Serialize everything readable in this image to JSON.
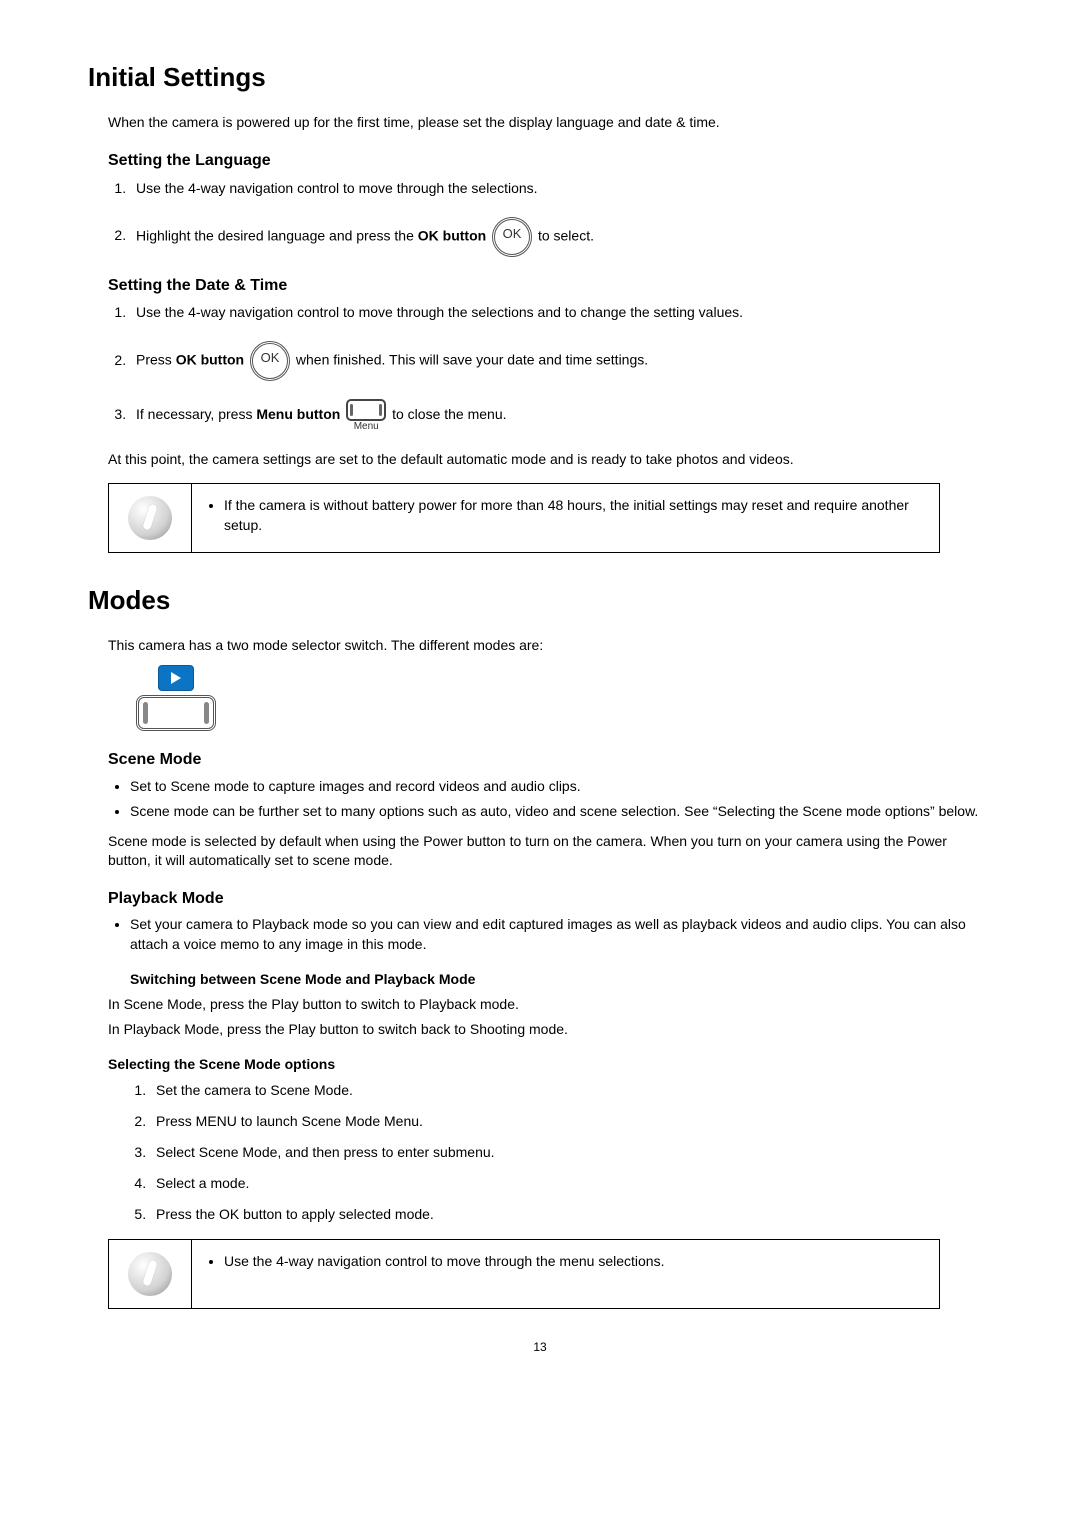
{
  "page_number": "13",
  "section1": {
    "title": "Initial Settings",
    "intro": "When the camera is powered up for the first time, please set the display language and date & time.",
    "lang": {
      "heading": "Setting the Language",
      "step1": "Use the 4-way navigation control to move through the selections.",
      "step2a": "Highlight the desired language and press the ",
      "step2b": "OK button",
      "step2c": " to select.",
      "ok_label": "OK"
    },
    "datetime": {
      "heading": "Setting the Date & Time",
      "step1": "Use the 4-way navigation control to move through the selections and to change the setting values.",
      "step2a": "Press ",
      "step2b": "OK button",
      "step2c": " when finished. This will save your date and time settings.",
      "ok_label": "OK",
      "step3a": "If necessary, press ",
      "step3b": "Menu button",
      "step3c": " to close the menu.",
      "menu_label": "Menu"
    },
    "closing": "At this point, the camera settings are set to the default automatic mode and is ready to take photos and videos.",
    "note": "If the camera is without battery power for more than 48 hours, the initial settings may reset and require another setup."
  },
  "section2": {
    "title": "Modes",
    "intro": "This camera has a two mode selector switch. The different modes are:",
    "scene": {
      "heading": "Scene Mode",
      "bullet1": "Set to Scene mode to capture images and record videos and audio clips.",
      "bullet2": "Scene mode can be further set to many options such as auto, video and scene selection. See “Selecting the Scene mode options” below.",
      "para": "Scene mode is selected by default when using the Power button to turn on the camera. When you turn on your camera using the Power button, it will automatically set to scene mode."
    },
    "playback": {
      "heading": "Playback Mode",
      "bullet1": "Set your camera to Playback mode so you can view and edit captured images as well as playback videos and audio clips. You can also attach a voice memo to any image in this mode."
    },
    "switching": {
      "heading": "Switching between Scene Mode and Playback Mode",
      "line1": "In Scene Mode, press the Play button to switch to Playback mode.",
      "line2": "In Playback Mode, press the Play button to switch back to Shooting mode."
    },
    "selecting": {
      "heading": "Selecting the Scene Mode options",
      "s1": "Set the camera to Scene Mode.",
      "s2": "Press MENU to launch Scene Mode Menu.",
      "s3": "Select Scene Mode, and then press to enter submenu.",
      "s4": "Select a mode.",
      "s5": "Press the OK button to apply selected mode."
    },
    "note": "Use the 4-way navigation control to move through the menu selections."
  }
}
